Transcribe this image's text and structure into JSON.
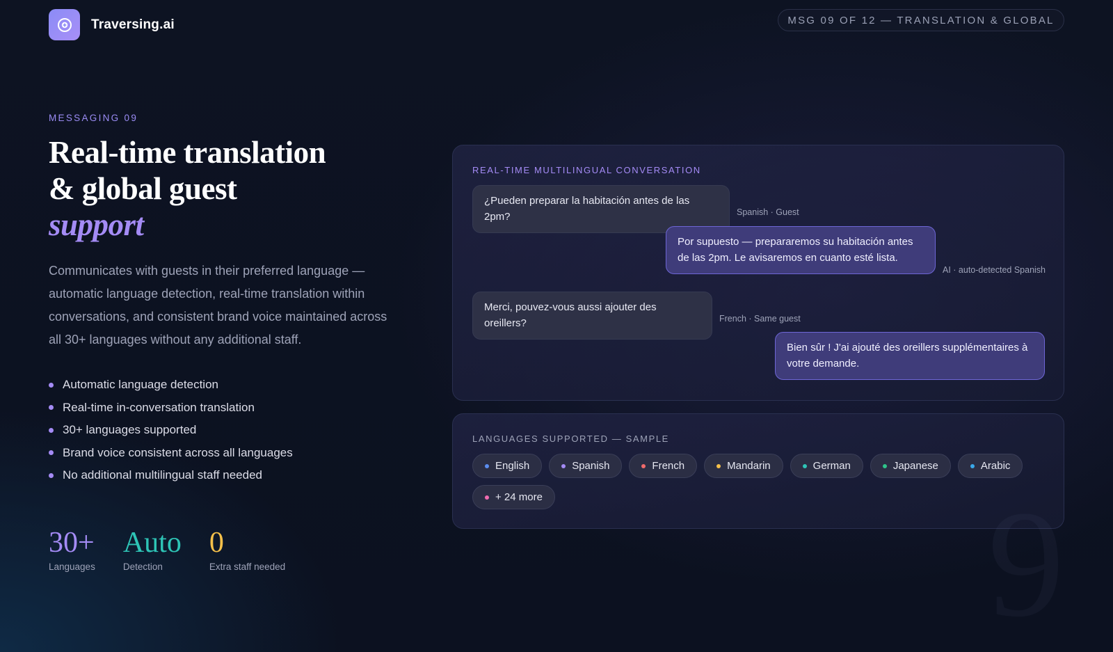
{
  "brand": {
    "name": "Traversing.ai",
    "logo_icon": "plus-circle-icon"
  },
  "header": {
    "progress_label": "MSG 09 OF 12 — TRANSLATION & GLOBAL"
  },
  "hero": {
    "eyebrow": "MESSAGING 09",
    "headline_line1": "Real-time translation",
    "headline_line2": "& global guest",
    "headline_accent": "support",
    "description": "Communicates with guests in their preferred language — automatic language detection, real-time translation within conversations, and consistent brand voice maintained across all 30+ languages without any additional staff."
  },
  "features": [
    "Automatic language detection",
    "Real-time in-conversation translation",
    "30+ languages supported",
    "Brand voice consistent across all languages",
    "No additional multilingual staff needed"
  ],
  "stats": [
    {
      "value": "30+",
      "label": "Languages",
      "color": "#a48bf5"
    },
    {
      "value": "Auto",
      "label": "Detection",
      "color": "#2ec4b6"
    },
    {
      "value": "0",
      "label": "Extra staff needed",
      "color": "#f5c04a"
    }
  ],
  "conversation": {
    "title": "REAL-TIME MULTILINGUAL CONVERSATION",
    "messages": [
      {
        "role": "guest",
        "text": "¿Pueden preparar la habitación antes de las 2pm?",
        "meta": "Spanish · Guest"
      },
      {
        "role": "ai",
        "text": "Por supuesto — prepararemos su habitación antes de las 2pm. Le avisaremos en cuanto esté lista.",
        "meta": "AI · auto-detected Spanish"
      },
      {
        "role": "guest",
        "text": "Merci, pouvez-vous aussi ajouter des oreillers?",
        "meta": "French · Same guest"
      },
      {
        "role": "ai",
        "text": "Bien sûr ! J'ai ajouté des oreillers supplémentaires à votre demande.",
        "meta": ""
      }
    ]
  },
  "languages": {
    "title": "LANGUAGES SUPPORTED — SAMPLE",
    "chips": [
      {
        "label": "English",
        "color": "#5b8def"
      },
      {
        "label": "Spanish",
        "color": "#a48bf5"
      },
      {
        "label": "French",
        "color": "#f06b6b"
      },
      {
        "label": "Mandarin",
        "color": "#f5c04a"
      },
      {
        "label": "German",
        "color": "#2ec4b6"
      },
      {
        "label": "Japanese",
        "color": "#2ec48a"
      },
      {
        "label": "Arabic",
        "color": "#3aa8e8"
      },
      {
        "label": "+ 24 more",
        "color": "#f06bb0"
      }
    ]
  },
  "slide_number": "9"
}
